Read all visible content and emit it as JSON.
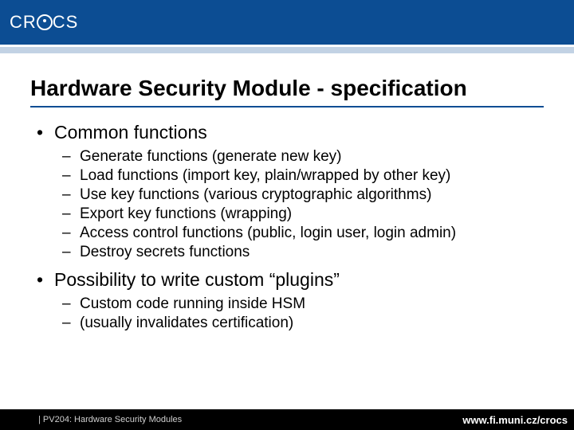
{
  "brand": "CROCS",
  "title": "Hardware Security Module - specification",
  "sections": [
    {
      "label": "Common functions",
      "items": [
        "Generate functions (generate new key)",
        "Load functions (import key, plain/wrapped by other key)",
        "Use key functions (various cryptographic algorithms)",
        "Export key functions (wrapping)",
        "Access control functions (public, login user, login admin)",
        "Destroy secrets functions"
      ]
    },
    {
      "label": "Possibility to write custom “plugins”",
      "items": [
        "Custom code running inside HSM",
        "(usually invalidates certification)"
      ]
    }
  ],
  "footer": {
    "left": "| PV204: Hardware Security Modules",
    "right": "www.fi.muni.cz/crocs"
  },
  "marks": {
    "l1": "•",
    "l2": "–"
  }
}
